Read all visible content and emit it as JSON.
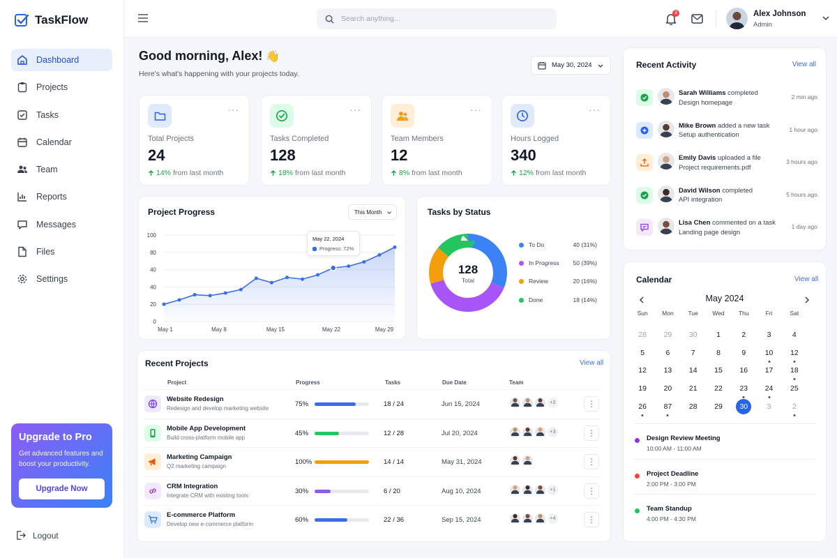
{
  "app": {
    "name": "TaskFlow"
  },
  "nav": {
    "items": [
      {
        "label": "Dashboard"
      },
      {
        "label": "Projects"
      },
      {
        "label": "Tasks"
      },
      {
        "label": "Calendar"
      },
      {
        "label": "Team"
      },
      {
        "label": "Reports"
      },
      {
        "label": "Messages"
      },
      {
        "label": "Files"
      },
      {
        "label": "Settings"
      }
    ],
    "active": "Dashboard"
  },
  "upgrade": {
    "title": "Upgrade to Pro",
    "text": "Get advanced features and boost your productivity.",
    "button": "Upgrade Now"
  },
  "logout": "Logout",
  "search": {
    "placeholder": "Search anything..."
  },
  "notifications": {
    "count": "3"
  },
  "user": {
    "name": "Alex Johnson",
    "role": "Admin"
  },
  "greeting": {
    "title": "Good morning, Alex!",
    "emoji": "👋",
    "subtitle": "Here's what's happening with your projects today."
  },
  "date_picker": {
    "value": "May 30, 2024"
  },
  "stats": [
    {
      "label": "Total Projects",
      "value": "24",
      "change": "14%",
      "change_text": "from last month",
      "icon": "folder-icon"
    },
    {
      "label": "Tasks Completed",
      "value": "128",
      "change": "18%",
      "change_text": "from last month",
      "icon": "check-circle-icon"
    },
    {
      "label": "Team Members",
      "value": "12",
      "change": "8%",
      "change_text": "from last month",
      "icon": "team-icon"
    },
    {
      "label": "Hours Logged",
      "value": "340",
      "change": "12%",
      "change_text": "from last month",
      "icon": "clock-icon"
    }
  ],
  "project_progress": {
    "title": "Project Progress",
    "filter": "This Month",
    "tooltip": {
      "date": "May 22, 2024",
      "label": "Progress: 72%"
    }
  },
  "tasks_by_status": {
    "title": "Tasks by Status",
    "total": "128",
    "total_label": "Total"
  },
  "chart_data": [
    {
      "type": "area",
      "title": "Project Progress",
      "y_ticks": [
        "0",
        "20",
        "40",
        "40",
        "80",
        "100"
      ],
      "x_ticks": [
        "May 1",
        "May 8",
        "May 15",
        "May 22",
        "May 29"
      ],
      "series": [
        {
          "x": [
            "May 1",
            "May 3",
            "May 5",
            "May 7",
            "May 9",
            "May 11",
            "May 13",
            "May 15",
            "May 17",
            "May 19",
            "May 21",
            "May 22",
            "May 24",
            "May 26",
            "May 28",
            "May 30"
          ],
          "values": [
            20,
            25,
            31,
            30,
            33,
            37,
            50,
            45,
            51,
            49,
            54,
            62,
            64,
            69,
            77,
            86
          ]
        }
      ],
      "ylim": [
        0,
        100
      ],
      "grid": true,
      "color": "#3b6ee6"
    },
    {
      "type": "pie",
      "title": "Tasks by Status",
      "slices": [
        {
          "name": "To Do",
          "value": 40,
          "pct": "31%",
          "color": "#3b82f6"
        },
        {
          "name": "In Progress",
          "value": 50,
          "pct": "39%",
          "color": "#a855f7"
        },
        {
          "name": "Review",
          "value": 20,
          "pct": "16%",
          "color": "#f59e0b"
        },
        {
          "name": "Done",
          "value": 18,
          "pct": "14%",
          "color": "#22c55e"
        }
      ]
    }
  ],
  "recent_projects": {
    "title": "Recent Projects",
    "view_all": "View all",
    "columns": [
      "Project",
      "Progress",
      "Tasks",
      "Due Date",
      "Team"
    ],
    "rows": [
      {
        "name": "Website Redesign",
        "desc": "Redesign and develop marketing website",
        "progress_text": "75%",
        "progress": 75,
        "color": "#3b6ee6",
        "icon": "globe-icon",
        "tint": "#ede9fe",
        "ico_color": "#7c3aed",
        "done": "18",
        "total": "24",
        "due": "Jun 15, 2024",
        "more": "+2",
        "avatars": 3
      },
      {
        "name": "Mobile App Development",
        "desc": "Build cross-platform mobile app",
        "progress_text": "45%",
        "progress": 45,
        "color": "#22c55e",
        "icon": "phone-icon",
        "tint": "#dcfce7",
        "ico_color": "#16a34a",
        "done": "12",
        "total": "28",
        "due": "Jul 20, 2024",
        "more": "+3",
        "avatars": 3
      },
      {
        "name": "Marketing Campaign",
        "desc": "Q2 marketing campaign",
        "progress_text": "100%",
        "progress": 100,
        "color": "#f59e0b",
        "icon": "megaphone-icon",
        "tint": "#ffedd5",
        "ico_color": "#ea580c",
        "done": "14",
        "total": "14",
        "due": "May 31, 2024",
        "more": "",
        "avatars": 2
      },
      {
        "name": "CRM Integration",
        "desc": "Integrate CRM with existing tools",
        "progress_text": "30%",
        "progress": 30,
        "color": "#8b5cf6",
        "icon": "link-icon",
        "tint": "#f3e8ff",
        "ico_color": "#9333ea",
        "done": "6",
        "total": "20",
        "due": "Aug 10, 2024",
        "more": "+1",
        "avatars": 3
      },
      {
        "name": "E-commerce Platform",
        "desc": "Develop new e-commerce platform",
        "progress_text": "60%",
        "progress": 60,
        "color": "#3b6ee6",
        "icon": "cart-icon",
        "tint": "#dbeafe",
        "ico_color": "#2563eb",
        "done": "22",
        "total": "36",
        "due": "Sep 15, 2024",
        "more": "+4",
        "avatars": 3
      }
    ]
  },
  "recent_activity": {
    "title": "Recent Activity",
    "view_all": "View all",
    "items": [
      {
        "who": "Sarah Williams",
        "action": "completed",
        "target": "Design homepage",
        "time": "2 min ago",
        "icon": "check-icon",
        "tint": "#dcfce7",
        "color": "#16a34a"
      },
      {
        "who": "Mike Brown",
        "action": "added a new task",
        "target": "Setup authentication",
        "time": "1 hour ago",
        "icon": "plus-icon",
        "tint": "#dbeafe",
        "color": "#2563eb"
      },
      {
        "who": "Emily Davis",
        "action": "uploaded a file",
        "target": "Project requirements.pdf",
        "time": "3 hours ago",
        "icon": "upload-icon",
        "tint": "#ffedd5",
        "color": "#ea580c"
      },
      {
        "who": "David Wilson",
        "action": "completed",
        "target": "API integration",
        "time": "5 hours ago",
        "icon": "check-icon",
        "tint": "#dcfce7",
        "color": "#16a34a"
      },
      {
        "who": "Lisa Chen",
        "action": "commented on a task",
        "target": "Landing page design",
        "time": "1 day ago",
        "icon": "comment-icon",
        "tint": "#f3e8ff",
        "color": "#9333ea"
      }
    ]
  },
  "calendar": {
    "title": "Calendar",
    "view_all": "View all",
    "month": "May 2024",
    "weekdays": [
      "Sun",
      "Mon",
      "Tue",
      "Wed",
      "Thu",
      "Fri",
      "Sat"
    ],
    "weeks": [
      [
        "28",
        "29",
        "30",
        "1",
        "2",
        "3",
        "4"
      ],
      [
        "5",
        "6",
        "7",
        "8",
        "9",
        "10",
        "12"
      ],
      [
        "12",
        "13",
        "14",
        "15",
        "16",
        "17",
        "18"
      ],
      [
        "19",
        "20",
        "21",
        "22",
        "23",
        "24",
        "25"
      ],
      [
        "26",
        "87",
        "28",
        "29",
        "30",
        "3",
        "2"
      ]
    ],
    "selected": "30",
    "events": [
      {
        "title": "Design Review Meeting",
        "time": "10:00 AM - 11:00 AM",
        "color": "#9333ea"
      },
      {
        "title": "Project Deadline",
        "time": "2:00 PM - 3:00 PM",
        "color": "#ef4444"
      },
      {
        "title": "Team Standup",
        "time": "4:00 PM - 4:30 PM",
        "color": "#22c55e"
      }
    ]
  }
}
